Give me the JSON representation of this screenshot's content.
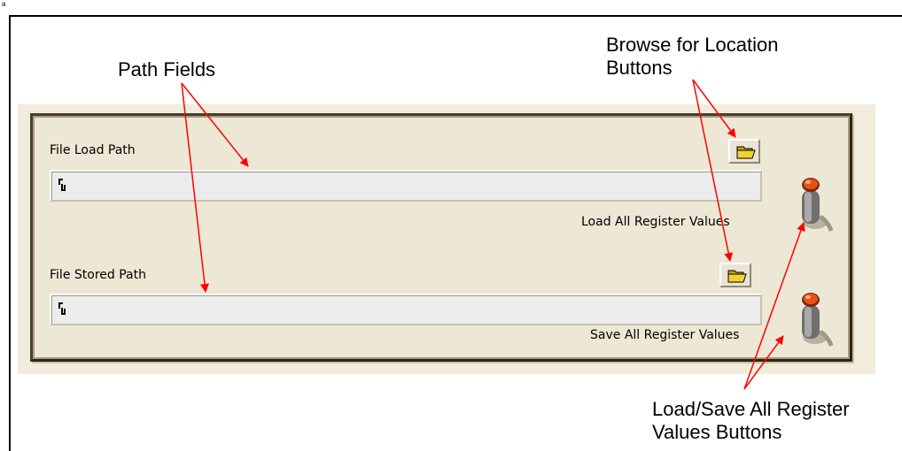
{
  "corner_mark": "a",
  "callouts": {
    "path_fields": "Path Fields",
    "browse_line1": "Browse for Location",
    "browse_line2": "Buttons",
    "loadsave_line1": "Load/Save All Register",
    "loadsave_line2": "Values Buttons"
  },
  "panel": {
    "load": {
      "label": "File Load Path",
      "value": "",
      "path_icon": "path-icon",
      "browse_icon": "folder-icon",
      "toggle_label": "Load All Register Values",
      "toggle_icon": "toggle-switch-icon"
    },
    "store": {
      "label": "File Stored Path",
      "value": "",
      "path_icon": "path-icon",
      "browse_icon": "folder-icon",
      "toggle_label": "Save All Register Values",
      "toggle_icon": "toggle-switch-icon"
    }
  },
  "colors": {
    "annotation_arrow": "#ff0000",
    "panel_background": "#ede7d5",
    "path_field": "#ececec",
    "toggle_led": "#e8501a"
  }
}
